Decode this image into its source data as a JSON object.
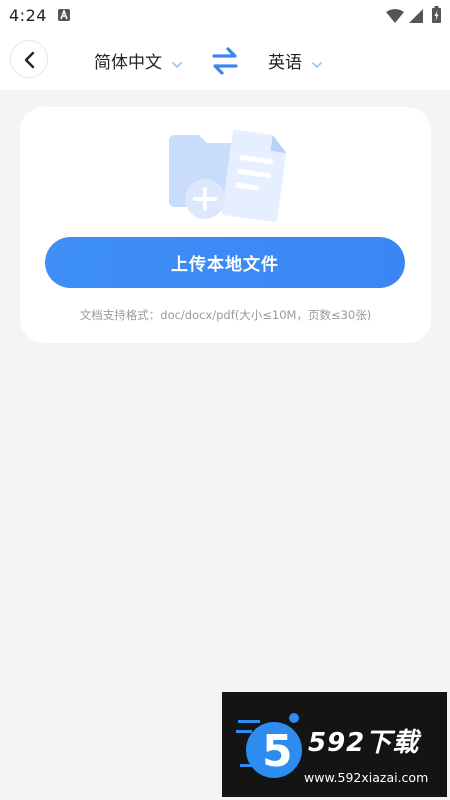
{
  "status_bar": {
    "time": "4:24",
    "app_icon": "a-app-icon",
    "wifi_icon": "wifi-icon",
    "signal_icon": "signal-icon",
    "battery_icon": "battery-charging-icon"
  },
  "top_bar": {
    "back_icon": "chevron-left-icon",
    "source_language": "简体中文",
    "target_language": "英语",
    "swap_icon": "swap-arrows-icon",
    "accent_color": "#3a86f5"
  },
  "upload_card": {
    "illustration": "document-folder-add-icon",
    "upload_button_label": "上传本地文件",
    "format_hint": "文档支持格式：doc/docx/pdf(大小≤10M，页数≤30张)"
  },
  "watermark": {
    "brand": "592下载",
    "url": "www.592xiazai.com"
  }
}
